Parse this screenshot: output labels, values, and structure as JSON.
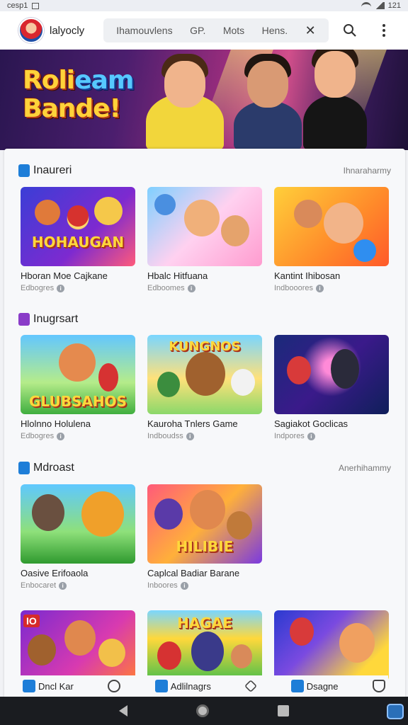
{
  "status_bar": {
    "left_text": "cesp1",
    "time": "121"
  },
  "app": {
    "name": "lalyocly"
  },
  "nav": {
    "items": [
      "Ihamouvlens",
      "GP.",
      "Mots",
      "Hens."
    ]
  },
  "hero": {
    "line1a": "Roli",
    "line1b": "eam",
    "line2": "Bande!"
  },
  "sections": [
    {
      "title": "Inaureri",
      "link": "Ihnaraharmy",
      "icon_color": "#1e7ed8",
      "games": [
        {
          "title": "Hboran Moe Cajkane",
          "meta": "Edbogres",
          "logo": "HOHAUGAN"
        },
        {
          "title": "Hbalc Hitfuana",
          "meta": "Edboomes",
          "logo": ""
        },
        {
          "title": "Kantint Ihibosan",
          "meta": "Indbooores",
          "logo": ""
        }
      ]
    },
    {
      "title": "Inugrsart",
      "link": "",
      "icon_color": "#8a3cc8",
      "games": [
        {
          "title": "Hlolnno Holulena",
          "meta": "Edbogres",
          "logo": "GLUBSAHOS"
        },
        {
          "title": "Kauroha Tnlers Game",
          "meta": "Indboudss",
          "logo": "KUNGNOS"
        },
        {
          "title": "Sagiakot Goclicas",
          "meta": "Indpores",
          "logo": ""
        }
      ]
    },
    {
      "title": "Mdroast",
      "link": "Anerhihammy",
      "icon_color": "#1e7ed8",
      "games": [
        {
          "title": "Oasive Erifoaola",
          "meta": "Enbocaret",
          "logo": ""
        },
        {
          "title": "Caplcal Badiar Barane",
          "meta": "Inboores",
          "logo": "HILIBIE"
        }
      ]
    }
  ],
  "bottom_row": {
    "logo_a": "IO",
    "logo_b": "HAGAE"
  },
  "bottom_tabs": [
    {
      "label": "Dncl Kar",
      "icon": "home-square-icon"
    },
    {
      "label": "",
      "icon": "circle-icon"
    },
    {
      "label": "Adlilnagrs",
      "icon": "grid-icon"
    },
    {
      "label": "",
      "icon": "hex-icon"
    },
    {
      "label": "Dsagne",
      "icon": "chat-icon"
    },
    {
      "label": "",
      "icon": "shield-icon"
    }
  ],
  "colors": {
    "accent": "#1e7ed8",
    "hero_gold": "#ffd23a",
    "hero_blue": "#56c8ff"
  }
}
